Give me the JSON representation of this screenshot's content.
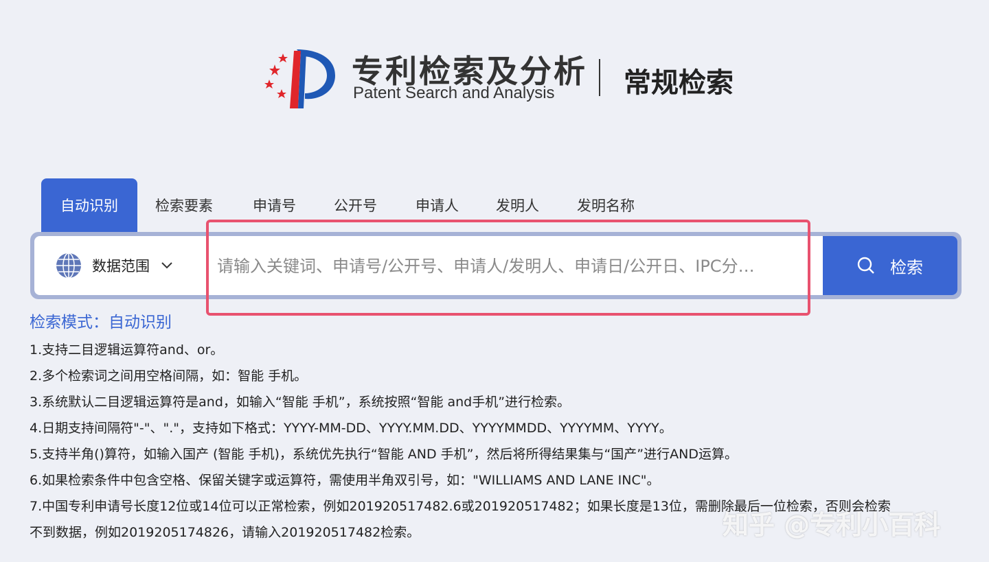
{
  "header": {
    "brand_cn": "专利检索及分析",
    "brand_en": "Patent Search and Analysis",
    "section_title": "常规检索"
  },
  "tabs": [
    {
      "label": "自动识别",
      "active": true
    },
    {
      "label": "检索要素",
      "active": false
    },
    {
      "label": "申请号",
      "active": false
    },
    {
      "label": "公开号",
      "active": false
    },
    {
      "label": "申请人",
      "active": false
    },
    {
      "label": "发明人",
      "active": false
    },
    {
      "label": "发明名称",
      "active": false
    }
  ],
  "search": {
    "scope_label": "数据范围",
    "placeholder": "请输入关键词、申请号/公开号、申请人/发明人、申请日/公开日、IPC分…",
    "button_label": "检索"
  },
  "help": {
    "mode": "检索模式：自动识别",
    "lines": [
      "1.支持二目逻辑运算符and、or。",
      "2.多个检索词之间用空格间隔，如：智能 手机。",
      "3.系统默认二目逻辑运算符是and，如输入“智能 手机”，系统按照“智能 and手机”进行检索。",
      "4.日期支持间隔符\"-\"、\".\"，支持如下格式：YYYY-MM-DD、YYYY.MM.DD、YYYYMMDD、YYYYMM、YYYY。",
      "5.支持半角()算符，如输入国产 (智能 手机)，系统优先执行“智能 AND 手机”，然后将所得结果集与“国产”进行AND运算。",
      "6.如果检索条件中包含空格、保留关键字或运算符，需使用半角双引号，如：\"WILLIAMS AND LANE INC\"。",
      "7.中国专利申请号长度12位或14位可以正常检索，例如201920517482.6或201920517482；如果长度是13位，需删除最后一位检索，否则会检索",
      "不到数据，例如2019205174826，请输入201920517482检索。"
    ]
  },
  "watermark": "知乎 @专利小百科",
  "colors": {
    "accent": "#3a66d3",
    "highlight": "#e8526f",
    "background": "#eef0f6"
  }
}
